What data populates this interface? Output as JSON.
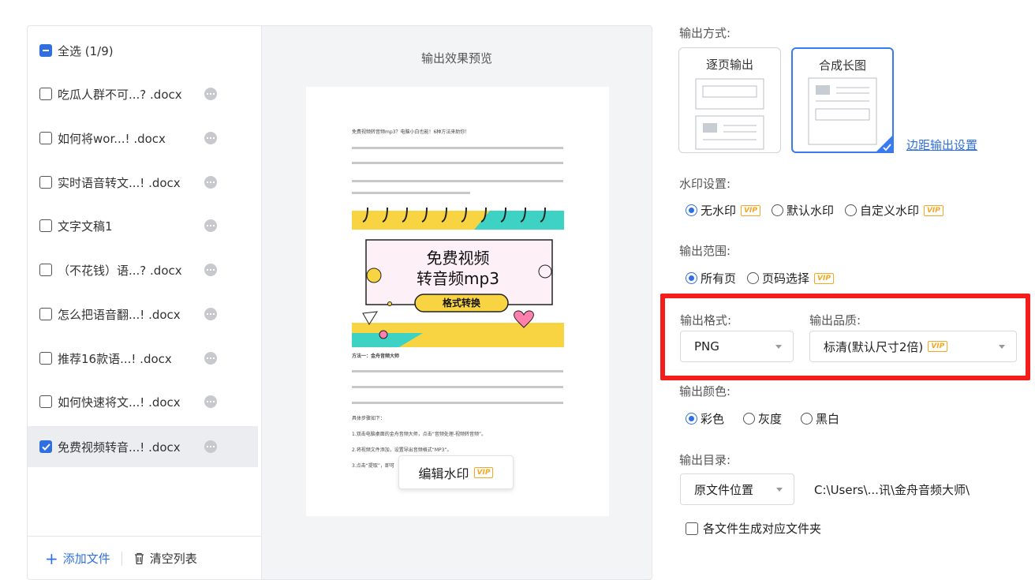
{
  "file_panel": {
    "select_all": "全选 (1/9)",
    "files": [
      {
        "name": "吃瓜人群不可...? .docx",
        "checked": false
      },
      {
        "name": "如何将wor...! .docx",
        "checked": false
      },
      {
        "name": "实时语音转文...! .docx",
        "checked": false
      },
      {
        "name": "文字文稿1",
        "checked": false
      },
      {
        "name": "（不花钱）语...? .docx",
        "checked": false
      },
      {
        "name": "怎么把语音翻...! .docx",
        "checked": false
      },
      {
        "name": "推荐16款语...! .docx",
        "checked": false
      },
      {
        "name": "如何快速将文...! .docx",
        "checked": false
      },
      {
        "name": "免费视频转音...! .docx",
        "checked": true
      }
    ],
    "add_file": "添加文件",
    "clear_list": "清空列表"
  },
  "preview": {
    "title": "输出效果预览",
    "doc_heading": "免费视频转音频mp3？电脑小白也能！6种方法来助你！",
    "banner_line1": "免费视频",
    "banner_line2": "转音频mp3",
    "banner_tag": "格式转换",
    "section_heading": "方法一：金舟音频大师",
    "steps_label": "具体步骤如下：",
    "step1": "1.双击电脑桌面的金舟音频大师，点击“音频处理-视频转音频”。",
    "step2": "2.将视频文件添加，设置导出音频格式“MP3”。",
    "step3": "3.点击“提取”，即可",
    "edit_watermark": "编辑水印",
    "vip": "VIP"
  },
  "settings": {
    "output_mode_label": "输出方式:",
    "mode_per_page": "逐页输出",
    "mode_long_image": "合成长图",
    "margin_link": "边距输出设置",
    "watermark_label": "水印设置:",
    "wm_none": "无水印",
    "wm_default": "默认水印",
    "wm_custom": "自定义水印",
    "range_label": "输出范围:",
    "range_all": "所有页",
    "range_select": "页码选择",
    "format_label": "输出格式:",
    "format_value": "PNG",
    "quality_label": "输出品质:",
    "quality_value": "标清(默认尺寸2倍)",
    "color_label": "输出颜色:",
    "color_full": "彩色",
    "color_gray": "灰度",
    "color_bw": "黑白",
    "dir_label": "输出目录:",
    "dir_select": "原文件位置",
    "dir_path": "C:\\Users\\...讯\\金舟音频大师\\",
    "per_folder": "各文件生成对应文件夹",
    "vip": "VIP"
  },
  "colors": {
    "accent": "#2f6fe0",
    "vip": "#f6a623",
    "highlight": "#f51c1c"
  }
}
